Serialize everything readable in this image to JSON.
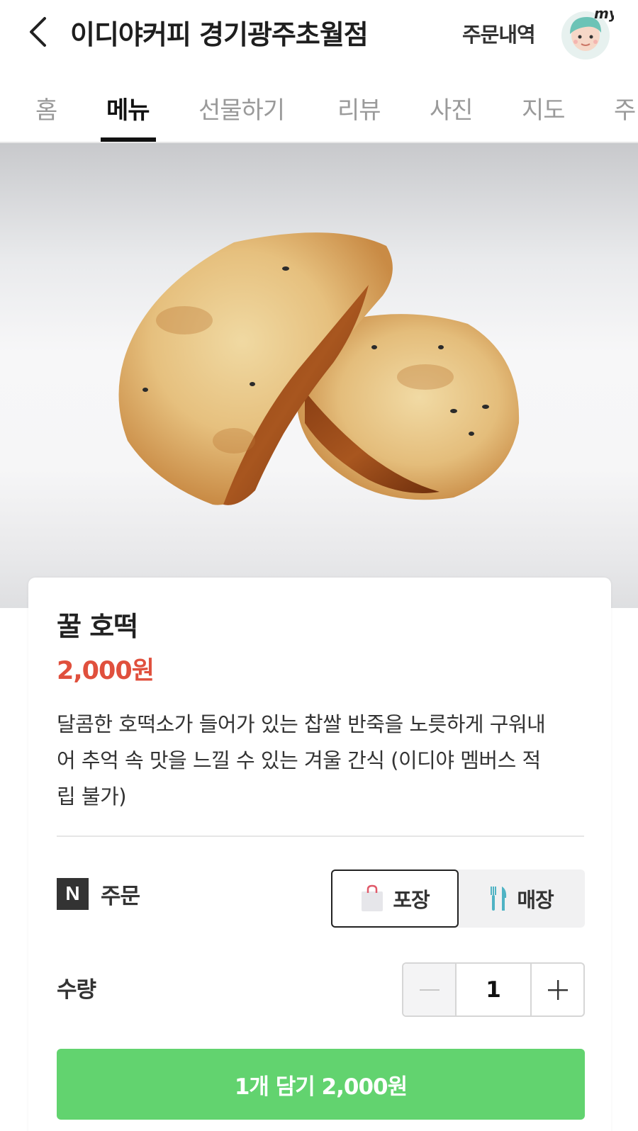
{
  "header": {
    "store_name": "이디야커피 경기광주초월점",
    "order_history": "주문내역",
    "avatar_badge": "my"
  },
  "tabs": [
    {
      "label": "홈",
      "active": false
    },
    {
      "label": "메뉴",
      "active": true
    },
    {
      "label": "선물하기",
      "active": false
    },
    {
      "label": "리뷰",
      "active": false
    },
    {
      "label": "사진",
      "active": false
    },
    {
      "label": "지도",
      "active": false
    },
    {
      "label": "주",
      "active": false
    }
  ],
  "item": {
    "name": "꿀 호떡",
    "price": "2,000원",
    "description_lines": [
      "달콤한 호떡소가 들어가 있는 찹쌀 반죽을 노릇하게 구워내",
      "어 추억 속 맛을 느낄 수 있는 겨울 간식 (이디야 멤버스 적",
      "립 불가)"
    ]
  },
  "order": {
    "badge": "N",
    "label": "주문",
    "options": [
      {
        "label": "포장",
        "icon": "shopping-bag-icon",
        "selected": true
      },
      {
        "label": "매장",
        "icon": "fork-knife-icon",
        "selected": false
      }
    ]
  },
  "quantity": {
    "label": "수량",
    "value": "1",
    "minus_symbol": "−",
    "plus_symbol": "+"
  },
  "cta": {
    "label": "1개 담기 2,000원"
  },
  "colors": {
    "price": "#e0503d",
    "cta": "#62d36f",
    "active_tab": "#111111",
    "inactive_tab": "#9a9a9a"
  }
}
